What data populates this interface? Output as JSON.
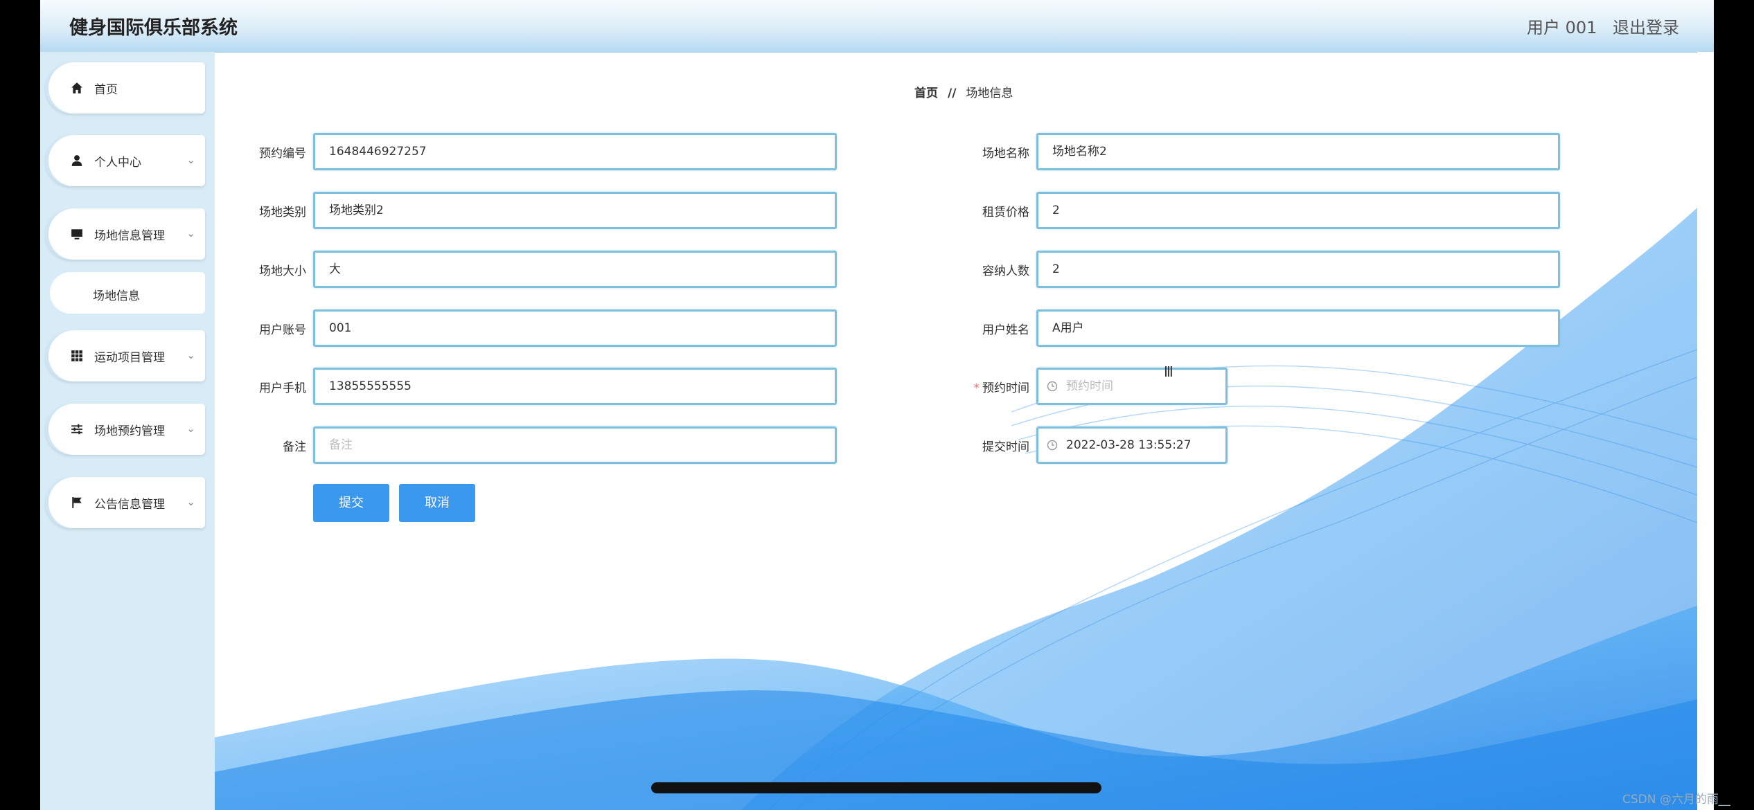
{
  "header": {
    "title": "健身国际俱乐部系统",
    "user": "用户 001",
    "logout": "退出登录"
  },
  "sidebar": {
    "items": [
      {
        "label": "首页",
        "icon": "home-icon"
      },
      {
        "label": "个人中心",
        "icon": "user-icon"
      },
      {
        "label": "场地信息管理",
        "icon": "monitor-icon"
      },
      {
        "label": "运动项目管理",
        "icon": "grid-icon"
      },
      {
        "label": "场地预约管理",
        "icon": "sliders-icon"
      },
      {
        "label": "公告信息管理",
        "icon": "flag-icon"
      }
    ],
    "sub_item": "场地信息"
  },
  "breadcrumb": {
    "home": "首页",
    "separator": "//",
    "current": "场地信息"
  },
  "form": {
    "booking_no": {
      "label": "预约编号",
      "value": "1648446927257"
    },
    "venue_name": {
      "label": "场地名称",
      "value": "场地名称2"
    },
    "venue_type": {
      "label": "场地类别",
      "value": "场地类别2"
    },
    "rent_price": {
      "label": "租赁价格",
      "value": "2"
    },
    "venue_size": {
      "label": "场地大小",
      "value": "大"
    },
    "capacity": {
      "label": "容纳人数",
      "value": "2"
    },
    "user_account": {
      "label": "用户账号",
      "value": "001"
    },
    "user_name": {
      "label": "用户姓名",
      "value": "A用户"
    },
    "user_phone": {
      "label": "用户手机",
      "value": "13855555555"
    },
    "booking_time": {
      "label": "预约时间",
      "placeholder": "预约时间",
      "required_mark": "*"
    },
    "remark": {
      "label": "备注",
      "placeholder": "备注"
    },
    "submit_time": {
      "label": "提交时间",
      "value": "2022-03-28 13:55:27"
    }
  },
  "buttons": {
    "submit": "提交",
    "cancel": "取消"
  },
  "watermark": "CSDN @六月的雨__",
  "colors": {
    "accent": "#3a98ef",
    "input_border": "#7fbfde",
    "sidebar_bg": "#d8ecf8"
  }
}
